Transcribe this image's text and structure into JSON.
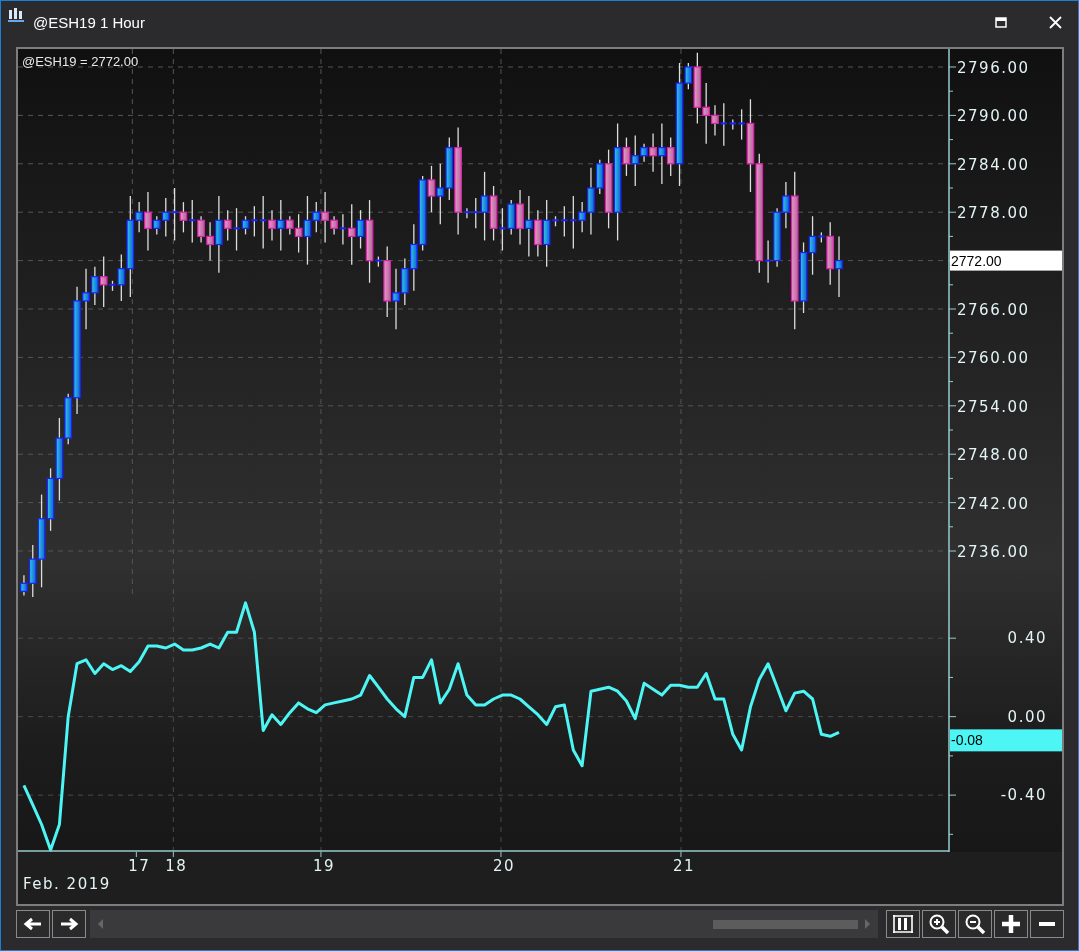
{
  "window": {
    "title": "@ESH19 1 Hour"
  },
  "price_pane": {
    "legend": "@ESH19 = 2772.00",
    "last_price": "2772.00",
    "chart_data": {
      "type": "candlestick",
      "grid": true,
      "ylim": [
        2730.3,
        2798.23
      ],
      "yticks": [
        {
          "value": 2796,
          "label": "2796.00"
        },
        {
          "value": 2790,
          "label": "2790.00"
        },
        {
          "value": 2784,
          "label": "2784.00"
        },
        {
          "value": 2778,
          "label": "2778.00"
        },
        {
          "value": 2766,
          "label": "2766.00"
        },
        {
          "value": 2760,
          "label": "2760.00"
        },
        {
          "value": 2754,
          "label": "2754.00"
        },
        {
          "value": 2748,
          "label": "2748.00"
        },
        {
          "value": 2742,
          "label": "2742.00"
        },
        {
          "value": 2736,
          "label": "2736.00"
        }
      ],
      "xlim": [
        17.317,
        22.489
      ],
      "x": [
        17.35,
        17.399,
        17.448,
        17.498,
        17.547,
        17.596,
        17.645,
        17.695,
        17.744,
        17.793,
        17.842,
        17.891,
        17.941,
        17.99,
        18.039,
        18.088,
        18.138,
        18.187,
        18.236,
        18.285,
        18.334,
        18.384,
        18.433,
        18.482,
        18.531,
        18.581,
        18.63,
        18.679,
        18.728,
        18.777,
        18.827,
        18.876,
        18.925,
        18.974,
        19.023,
        19.073,
        19.122,
        19.171,
        19.22,
        19.27,
        19.319,
        19.368,
        19.417,
        19.466,
        19.516,
        19.565,
        19.614,
        19.663,
        19.713,
        19.762,
        19.811,
        19.86,
        19.909,
        19.959,
        20.008,
        20.057,
        20.106,
        20.155,
        20.205,
        20.254,
        20.303,
        20.352,
        20.402,
        20.451,
        20.5,
        20.549,
        20.598,
        20.648,
        20.697,
        20.746,
        20.795,
        20.845,
        20.894,
        20.943,
        20.992,
        21.041,
        21.091,
        21.14,
        21.189,
        21.238,
        21.288,
        21.337,
        21.386,
        21.435,
        21.484,
        21.534,
        21.583,
        21.632,
        21.681,
        21.731,
        21.78,
        21.829,
        21.878
      ],
      "ohlc": [
        [
          2731,
          2733,
          2730.5,
          2732
        ],
        [
          2732,
          2736.75,
          2730,
          2735
        ],
        [
          2735,
          2743,
          2731.5,
          2740
        ],
        [
          2740,
          2746.25,
          2738.5,
          2745
        ],
        [
          2745,
          2752.5,
          2742.25,
          2750
        ],
        [
          2750,
          2755.5,
          2749.25,
          2755
        ],
        [
          2755,
          2768.75,
          2753,
          2767
        ],
        [
          2767,
          2771,
          2763.5,
          2768
        ],
        [
          2768,
          2771.25,
          2766.5,
          2770
        ],
        [
          2770,
          2772.5,
          2766.25,
          2769
        ],
        [
          2769,
          2769.5,
          2768.25,
          2769
        ],
        [
          2769,
          2772.75,
          2767,
          2771
        ],
        [
          2771,
          2780,
          2767.5,
          2777
        ],
        [
          2777,
          2779.25,
          2775.5,
          2778
        ],
        [
          2778,
          2780.5,
          2773.25,
          2776
        ],
        [
          2776,
          2777.5,
          2775.25,
          2777
        ],
        [
          2777,
          2779.75,
          2775,
          2778
        ],
        [
          2778,
          2781,
          2774.5,
          2778
        ],
        [
          2778,
          2779.25,
          2775.5,
          2777
        ],
        [
          2777,
          2779.5,
          2774.25,
          2777
        ],
        [
          2777,
          2777.5,
          2774.25,
          2775
        ],
        [
          2775,
          2776.75,
          2772,
          2774
        ],
        [
          2774,
          2780,
          2770.5,
          2777
        ],
        [
          2777,
          2778.25,
          2774.5,
          2776
        ],
        [
          2776,
          2778.5,
          2773.25,
          2776
        ],
        [
          2776,
          2777.5,
          2775.25,
          2777
        ],
        [
          2777,
          2778.75,
          2775,
          2777
        ],
        [
          2777,
          2780,
          2773.5,
          2777
        ],
        [
          2777,
          2778.25,
          2774.5,
          2776
        ],
        [
          2776,
          2779.5,
          2773.25,
          2777
        ],
        [
          2777,
          2777.5,
          2775.25,
          2776
        ],
        [
          2776,
          2777.75,
          2773,
          2775
        ],
        [
          2775,
          2780,
          2771.5,
          2777
        ],
        [
          2777,
          2779.25,
          2775.5,
          2778
        ],
        [
          2778,
          2780.5,
          2774.25,
          2777
        ],
        [
          2777,
          2777.5,
          2775.25,
          2776
        ],
        [
          2776,
          2777.75,
          2774,
          2776
        ],
        [
          2776,
          2779,
          2771.5,
          2775
        ],
        [
          2775,
          2778.25,
          2773.5,
          2777
        ],
        [
          2777,
          2779.5,
          2769.25,
          2772
        ],
        [
          2772,
          2772.5,
          2771.25,
          2772
        ],
        [
          2772,
          2773.75,
          2765,
          2767
        ],
        [
          2767,
          2771,
          2763.5,
          2768
        ],
        [
          2768,
          2772.25,
          2766.5,
          2771
        ],
        [
          2771,
          2776.5,
          2768.25,
          2774
        ],
        [
          2774,
          2782.5,
          2773.25,
          2782
        ],
        [
          2782,
          2783.75,
          2778,
          2780
        ],
        [
          2780,
          2784,
          2776.5,
          2781
        ],
        [
          2781,
          2787.25,
          2779.5,
          2786
        ],
        [
          2786,
          2788.5,
          2775.25,
          2778
        ],
        [
          2778,
          2778.5,
          2777.25,
          2778
        ],
        [
          2778,
          2779.75,
          2776,
          2778
        ],
        [
          2778,
          2783,
          2774.5,
          2780
        ],
        [
          2780,
          2781.25,
          2774.5,
          2776
        ],
        [
          2776,
          2778.5,
          2773.25,
          2776
        ],
        [
          2776,
          2779.5,
          2775.25,
          2779
        ],
        [
          2779,
          2780.75,
          2774,
          2776
        ],
        [
          2776,
          2780,
          2772.5,
          2777
        ],
        [
          2777,
          2778.25,
          2772.5,
          2774
        ],
        [
          2774,
          2779.5,
          2771.25,
          2777
        ],
        [
          2777,
          2777.5,
          2776.25,
          2777
        ],
        [
          2777,
          2778.75,
          2775,
          2777
        ],
        [
          2777,
          2780,
          2773.5,
          2777
        ],
        [
          2777,
          2779.25,
          2775.5,
          2778
        ],
        [
          2778,
          2783.5,
          2775.25,
          2781
        ],
        [
          2781,
          2784.5,
          2780.25,
          2784
        ],
        [
          2784,
          2785.75,
          2776,
          2778
        ],
        [
          2778,
          2789,
          2774.5,
          2786
        ],
        [
          2786,
          2787.25,
          2782.5,
          2784
        ],
        [
          2784,
          2787.5,
          2781.25,
          2785
        ],
        [
          2785,
          2786.5,
          2784.25,
          2786
        ],
        [
          2786,
          2787.75,
          2783,
          2785
        ],
        [
          2785,
          2789,
          2781.5,
          2786
        ],
        [
          2786,
          2787.25,
          2782.5,
          2784
        ],
        [
          2784,
          2796.5,
          2781.25,
          2794
        ],
        [
          2794,
          2796.5,
          2793.25,
          2796
        ],
        [
          2796,
          2797.75,
          2789,
          2791
        ],
        [
          2791,
          2794,
          2786.5,
          2790
        ],
        [
          2790,
          2791.25,
          2787.5,
          2789
        ],
        [
          2789,
          2791.5,
          2786.25,
          2789
        ],
        [
          2789,
          2789.5,
          2788.25,
          2789
        ],
        [
          2789,
          2790.75,
          2787,
          2789
        ],
        [
          2789,
          2792,
          2780.5,
          2784
        ],
        [
          2784,
          2785.25,
          2770.5,
          2772
        ],
        [
          2772,
          2774.5,
          2769.25,
          2772
        ],
        [
          2772,
          2778.5,
          2771.25,
          2778
        ],
        [
          2778,
          2781.75,
          2776,
          2780
        ],
        [
          2780,
          2783,
          2763.5,
          2767
        ],
        [
          2767,
          2774.25,
          2765.5,
          2773
        ],
        [
          2773,
          2777.5,
          2770.25,
          2775
        ],
        [
          2775,
          2775.5,
          2774.25,
          2775
        ],
        [
          2775,
          2776.75,
          2769,
          2771
        ],
        [
          2771,
          2775,
          2767.5,
          2772
        ]
      ]
    }
  },
  "oscillator_pane": {
    "last_value": "-0.08",
    "chart_data": {
      "type": "line",
      "grid": true,
      "ylim": [
        -0.69,
        0.61
      ],
      "xlim": [
        17.317,
        22.489
      ],
      "yticks": [
        {
          "value": 0.4,
          "label": "0.40"
        },
        {
          "value": 0,
          "label": "0.00"
        },
        {
          "value": -0.4,
          "label": "-0.40"
        }
      ],
      "xticks": [
        {
          "value": 18.18,
          "label": "18"
        },
        {
          "value": 19,
          "label": "19"
        },
        {
          "value": 20,
          "label": "20"
        },
        {
          "value": 21,
          "label": "21"
        }
      ],
      "x": [
        17.35,
        17.399,
        17.448,
        17.498,
        17.547,
        17.596,
        17.645,
        17.695,
        17.744,
        17.793,
        17.842,
        17.891,
        17.941,
        17.99,
        18.039,
        18.088,
        18.138,
        18.187,
        18.236,
        18.285,
        18.334,
        18.384,
        18.433,
        18.482,
        18.531,
        18.581,
        18.63,
        18.679,
        18.728,
        18.777,
        18.827,
        18.876,
        18.925,
        18.974,
        19.023,
        19.073,
        19.122,
        19.171,
        19.22,
        19.27,
        19.319,
        19.368,
        19.417,
        19.466,
        19.516,
        19.565,
        19.614,
        19.663,
        19.713,
        19.762,
        19.811,
        19.86,
        19.909,
        19.959,
        20.008,
        20.057,
        20.106,
        20.155,
        20.205,
        20.254,
        20.303,
        20.352,
        20.402,
        20.451,
        20.5,
        20.549,
        20.598,
        20.648,
        20.697,
        20.746,
        20.795,
        20.845,
        20.894,
        20.943,
        20.992,
        21.041,
        21.091,
        21.14,
        21.189,
        21.238,
        21.288,
        21.337,
        21.386,
        21.435,
        21.484,
        21.534,
        21.583,
        21.632,
        21.681,
        21.731,
        21.78,
        21.829,
        21.878
      ],
      "series": [
        {
          "color": "#4df5f5",
          "values": [
            -0.35,
            -0.45,
            -0.55,
            -0.68,
            -0.55,
            0.0,
            0.27,
            0.29,
            0.22,
            0.27,
            0.24,
            0.26,
            0.23,
            0.28,
            0.36,
            0.36,
            0.35,
            0.37,
            0.34,
            0.34,
            0.35,
            0.37,
            0.35,
            0.43,
            0.43,
            0.58,
            0.43,
            -0.07,
            0.01,
            -0.04,
            0.02,
            0.07,
            0.04,
            0.02,
            0.06,
            0.07,
            0.08,
            0.09,
            0.11,
            0.21,
            0.15,
            0.09,
            0.04,
            0.0,
            0.2,
            0.2,
            0.29,
            0.07,
            0.14,
            0.27,
            0.11,
            0.06,
            0.06,
            0.09,
            0.11,
            0.11,
            0.09,
            0.05,
            0.01,
            -0.04,
            0.05,
            0.06,
            -0.17,
            -0.25,
            0.13,
            0.14,
            0.15,
            0.13,
            0.08,
            -0.01,
            0.17,
            0.14,
            0.11,
            0.16,
            0.16,
            0.15,
            0.15,
            0.22,
            0.09,
            0.09,
            -0.09,
            -0.17,
            0.05,
            0.19,
            0.27,
            0.15,
            0.03,
            0.12,
            0.13,
            0.09,
            -0.09,
            -0.1,
            -0.08
          ]
        }
      ]
    }
  },
  "date_axis": {
    "session_label": "17",
    "month_label": "Feb. 2019"
  }
}
